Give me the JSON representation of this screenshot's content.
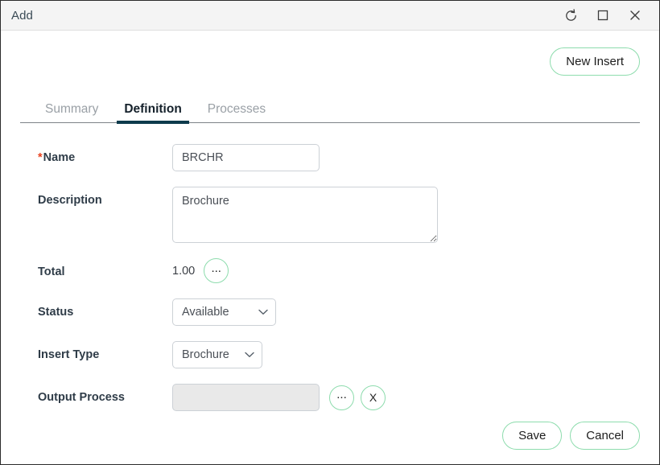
{
  "window": {
    "title": "Add",
    "controls": [
      {
        "name": "refresh-icon",
        "label": "Refresh"
      },
      {
        "name": "maximize-icon",
        "label": "Maximize"
      },
      {
        "name": "close-icon",
        "label": "Close"
      }
    ]
  },
  "toolbar": {
    "new_insert_label": "New Insert"
  },
  "tabs": [
    {
      "label": "Summary",
      "active": false
    },
    {
      "label": "Definition",
      "active": true
    },
    {
      "label": "Processes",
      "active": false
    }
  ],
  "form": {
    "name": {
      "label": "Name",
      "required_marker": "*",
      "value": "BRCHR",
      "placeholder": ""
    },
    "description": {
      "label": "Description",
      "value": "Brochure",
      "placeholder": ""
    },
    "total": {
      "label": "Total",
      "value": "1.00",
      "browse_label": "..."
    },
    "status": {
      "label": "Status",
      "value": "Available",
      "options": [
        "Available"
      ]
    },
    "insert_type": {
      "label": "Insert Type",
      "value": "Brochure",
      "options": [
        "Brochure"
      ]
    },
    "output_process": {
      "label": "Output Process",
      "value": "",
      "placeholder": "",
      "browse_label": "...",
      "clear_label": "X"
    }
  },
  "footer": {
    "save_label": "Save",
    "cancel_label": "Cancel"
  },
  "colors": {
    "accent_green": "#8ddcad",
    "active_tab_underline": "#0d3b4c",
    "required_asterisk": "#e8421f",
    "label_text": "#2f3c48",
    "titlebar_bg": "#f4f4f4"
  }
}
